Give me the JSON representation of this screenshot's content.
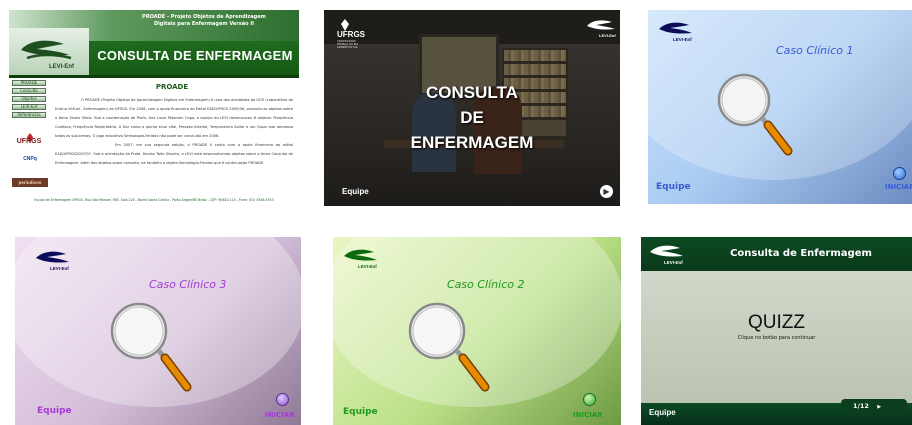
{
  "site": {
    "header_line1": "PROADE - Projeto Objetos de Aprendizagem",
    "header_line2": "Digitais para Enfermagem Versão II",
    "title": "CONSULTA DE ENFERMAGEM",
    "logo_text": "LEVI-Enf",
    "menu": [
      "PROADE",
      "Consulta",
      "Objetos",
      "LEVI-Enf",
      "Referências"
    ],
    "section_title": "PROADE",
    "paragraphs": [
      "O PROADE (Projeto Objetos de Aprendizagem Digitais em Enfermagem) é uma das atividades do LEVI (Laboratório de Ensino Virtual - Enfermagem) da UFRGS. Em 2006, com o apoio financeiro do Edital EAD/UFRGS 2005/06, produziu-se objetos sobre o tema Sinais Vitais. Sob a coordenação de Profa. Ana Luisa Petersen Cogo, a equipe do LEVI desenvolveu 6 objetos: Frequência Cardíaca, Frequência Respiratória, A Dor como o quinto sinal vital, Pressão Arterial, Temperatura Axilar e um Quizz que perpassa todos os sub-temas. O jogo educativo Semiologia-Feridas não pode ser concluído em 2006.",
      "Em 2007, em sua segunda edição, o PROADE II conta com o apoio financeiro do edital EAD/UFRGS2007/07. Sob a orientação da Profa. Denise Tolfo Silveira, o LEVI está desenvolvendo objetos sobre o tema Consulta de Enfermagem. Além dos objetos sobre consulta, há também o objeto Semiologia-Feridas que é continuação PROADE."
    ],
    "sponsors": [
      "UFRGS",
      "CNPq",
      "periodicos"
    ],
    "footer": "Escola de Enfermagem UFRGS. Rua São Manoel, 963. Sala 224 - Bairro Santa Cecília - Porto Alegre/RS Brasil - CEP: 90620-110 - Fone: (51) 3308-5353"
  },
  "video": {
    "institution": "UFRGS",
    "institution_sub": "UNIVERSIDADE FEDERAL DO RIO GRANDE DO SUL",
    "logo_text": "LEVI-Enf",
    "title_lines": [
      "CONSULTA",
      "DE",
      "ENFERMAGEM"
    ],
    "equipe": "Equipe",
    "next_icon": "▶"
  },
  "cases": [
    {
      "id": "p3",
      "title": "Caso Clínico 1",
      "equipe": "Equipe",
      "start": "INICIAR",
      "logo_text": "LEVI-Enf",
      "accent": "#3a5bd0",
      "button": "#2b6de0"
    },
    {
      "id": "p4",
      "title": "Caso Clínico 3",
      "equipe": "Equipe",
      "start": "INICIAR",
      "logo_text": "LEVI-Enf",
      "accent": "#a43bd6",
      "button": "#8a55c9"
    },
    {
      "id": "p5",
      "title": "Caso Clínico 2",
      "equipe": "Equipe",
      "start": "INICIAR",
      "logo_text": "LEVI-Enf",
      "accent": "#1f9a1f",
      "button": "#3aa83a"
    }
  ],
  "quiz": {
    "logo_text": "LEVI-Enf",
    "title": "Consulta de Enfermagem",
    "heading": "QUIZZ",
    "subtitle": "Clique no botão para continuar",
    "equipe": "Equipe",
    "pages": "1/12",
    "next_icon": "▶"
  }
}
